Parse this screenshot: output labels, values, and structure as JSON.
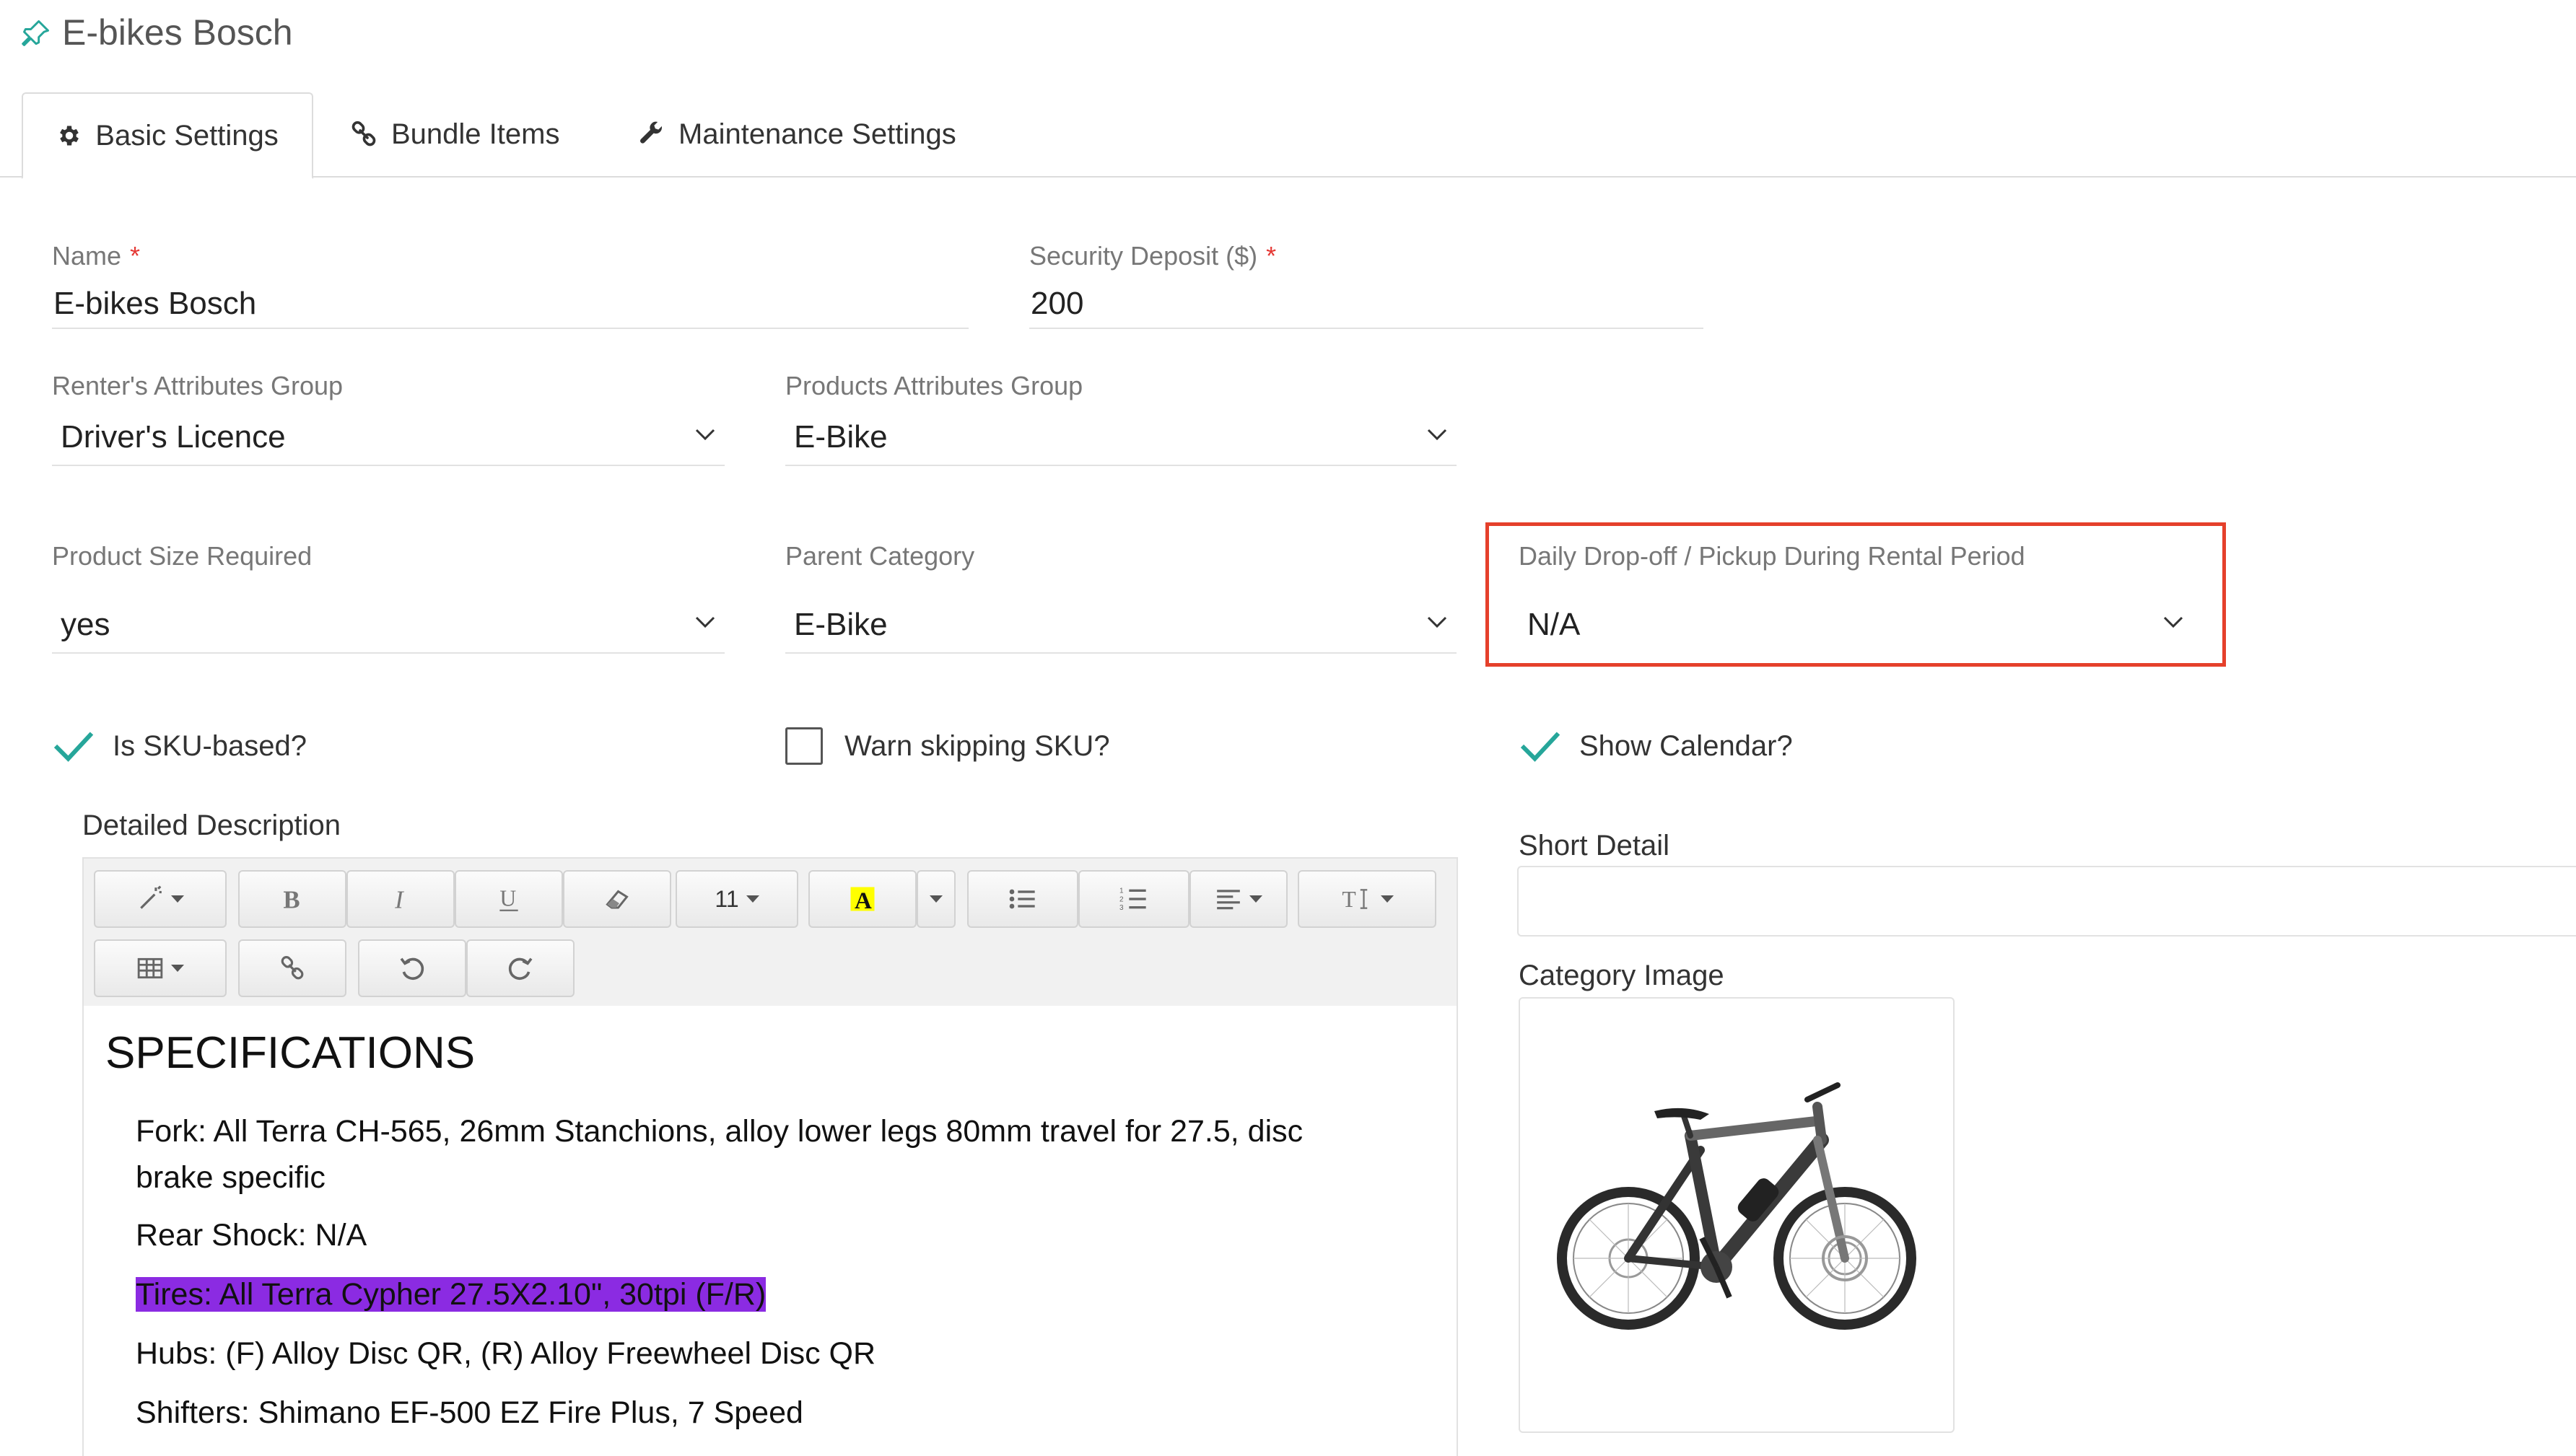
{
  "header": {
    "title": "E-bikes Bosch"
  },
  "tabs": [
    {
      "label": "Basic Settings",
      "icon": "gear-icon",
      "active": true
    },
    {
      "label": "Bundle Items",
      "icon": "link-icon",
      "active": false
    },
    {
      "label": "Maintenance Settings",
      "icon": "wrench-icon",
      "active": false
    }
  ],
  "form": {
    "name": {
      "label": "Name",
      "required_mark": "*",
      "value": "E-bikes Bosch"
    },
    "security_deposit": {
      "label": "Security Deposit ($)",
      "required_mark": "*",
      "value": "200"
    },
    "renters_group": {
      "label": "Renter's Attributes Group",
      "value": "Driver's Licence"
    },
    "products_group": {
      "label": "Products Attributes Group",
      "value": "E-Bike"
    },
    "size_required": {
      "label": "Product Size Required",
      "value": "yes"
    },
    "parent_category": {
      "label": "Parent Category",
      "value": "E-Bike"
    },
    "daily_dropoff": {
      "label": "Daily Drop-off / Pickup During Rental Period",
      "value": "N/A"
    },
    "is_sku": {
      "label": "Is SKU-based?",
      "checked": true
    },
    "warn_sku": {
      "label": "Warn skipping SKU?",
      "checked": false
    },
    "show_calendar": {
      "label": "Show Calendar?",
      "checked": true
    }
  },
  "editor": {
    "label": "Detailed Description",
    "font_size": "11",
    "heading": "SPECIFICATIONS",
    "lines": [
      "Fork: All Terra CH-565, 26mm Stanchions, alloy lower legs 80mm travel for 27.5, disc",
      "brake specific",
      "Rear Shock: N/A",
      "Tires: All Terra Cypher 27.5X2.10\", 30tpi (F/R)",
      "Hubs: (F) Alloy Disc QR, (R) Alloy Freewheel Disc QR",
      "Shifters: Shimano EF-500 EZ Fire Plus, 7 Speed"
    ]
  },
  "short_detail": {
    "label": "Short Detail",
    "value": ""
  },
  "category_image": {
    "label": "Category Image"
  },
  "colors": {
    "accent": "#26a69a",
    "highlight_border": "#e5402b",
    "text_highlight": "#8b2be2",
    "required": "#e53935"
  }
}
